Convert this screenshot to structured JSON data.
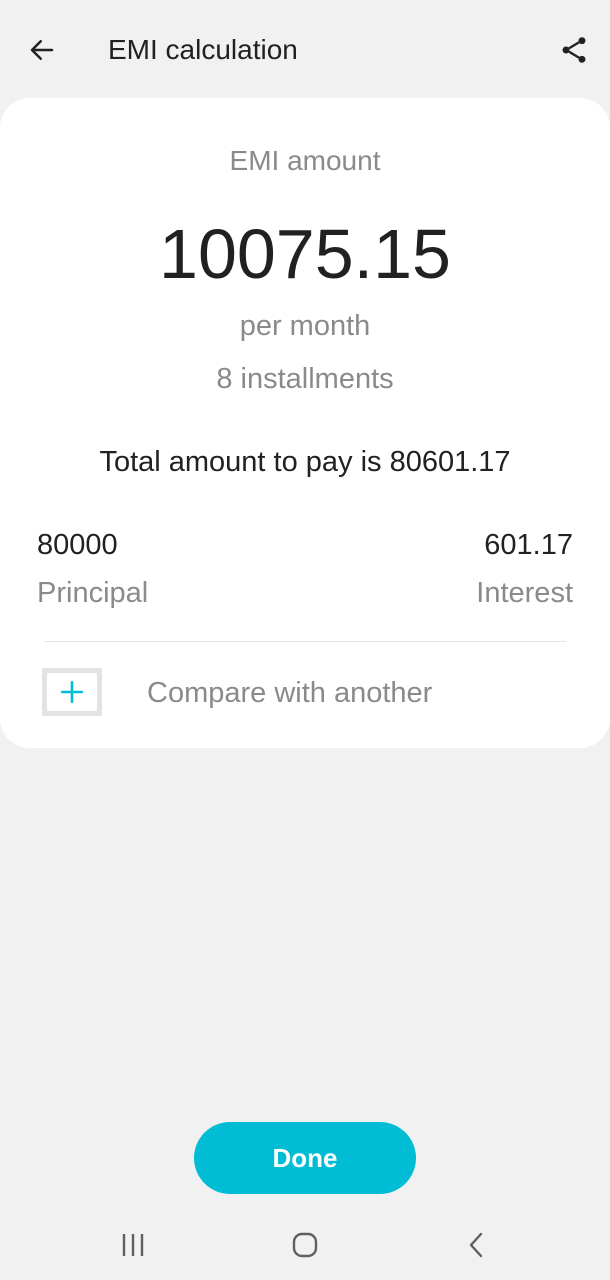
{
  "appbar": {
    "title": "EMI calculation",
    "back_icon": "arrow-left-icon",
    "share_icon": "share-icon"
  },
  "result": {
    "emi_label": "EMI amount",
    "emi_value": "10075.15",
    "per_month": "per month",
    "installments": "8 installments",
    "total_text": "Total amount to pay is 80601.17"
  },
  "breakdown": {
    "principal_value": "80000",
    "principal_label": "Principal",
    "interest_value": "601.17",
    "interest_label": "Interest"
  },
  "compare": {
    "icon": "plus-icon",
    "label": "Compare with another"
  },
  "actions": {
    "done_label": "Done"
  },
  "colors": {
    "accent": "#00bcd4",
    "background": "#f1f1f1",
    "card": "#ffffff",
    "secondary_text": "#8a8a8a",
    "primary_text": "#212121"
  },
  "system_nav": {
    "recent_icon": "recent-apps-icon",
    "home_icon": "home-icon",
    "back_icon": "back-chevron-icon"
  }
}
